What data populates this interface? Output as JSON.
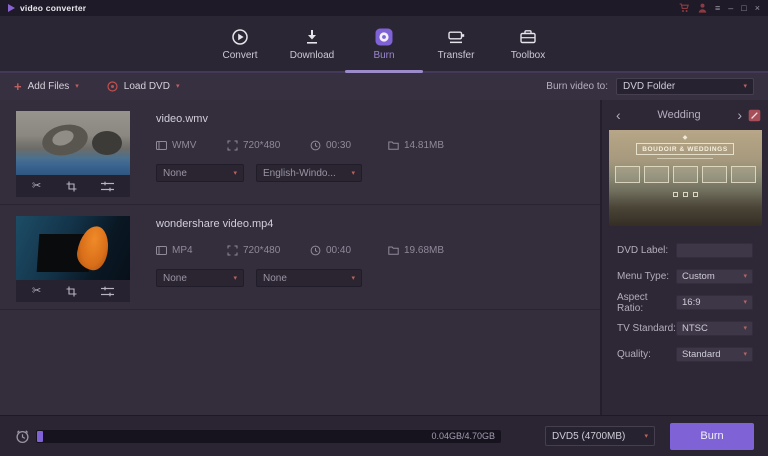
{
  "colors": {
    "accent_purple": "#7e62d6",
    "nav_active_purple": "#9a86cf",
    "accent_red": "#c0605c",
    "titlebar_red": "#8d3b43"
  },
  "icons": {
    "caret_down": "▾",
    "menu": "≡",
    "minimize": "–",
    "maximize": "□",
    "close": "×",
    "plus": "+",
    "back": "‹",
    "forward": "›",
    "scissors": "✂",
    "ornament": "◆"
  },
  "titlebar": {
    "app_name": "video converter"
  },
  "nav": {
    "tabs": [
      {
        "label": "Convert",
        "active": false
      },
      {
        "label": "Download",
        "active": false
      },
      {
        "label": "Burn",
        "active": true
      },
      {
        "label": "Transfer",
        "active": false
      },
      {
        "label": "Toolbox",
        "active": false
      }
    ]
  },
  "toolbar": {
    "add_files": "Add Files",
    "load_dvd": "Load DVD",
    "burn_to_label": "Burn video to:",
    "burn_to_value": "DVD Folder"
  },
  "files": [
    {
      "name": "video.wmv",
      "format": "WMV",
      "resolution": "720*480",
      "duration": "00:30",
      "size": "14.81MB",
      "audio": "None",
      "subtitle": "English-Windo..."
    },
    {
      "name": "wondershare video.mp4",
      "format": "MP4",
      "resolution": "720*480",
      "duration": "00:40",
      "size": "19.68MB",
      "audio": "None",
      "subtitle": "None"
    }
  ],
  "sidebar": {
    "category": "Wedding",
    "template_title": "BOUDOIR & WEDDINGS",
    "fields": [
      {
        "label": "DVD Label:",
        "value": ""
      },
      {
        "label": "Menu Type:",
        "value": "Custom"
      },
      {
        "label": "Aspect Ratio:",
        "value": "16:9"
      },
      {
        "label": "TV Standard:",
        "value": "NTSC"
      },
      {
        "label": "Quality:",
        "value": "Standard"
      }
    ]
  },
  "statusbar": {
    "usage": "0.04GB/4.70GB",
    "disc": "DVD5 (4700MB)",
    "burn": "Burn"
  }
}
